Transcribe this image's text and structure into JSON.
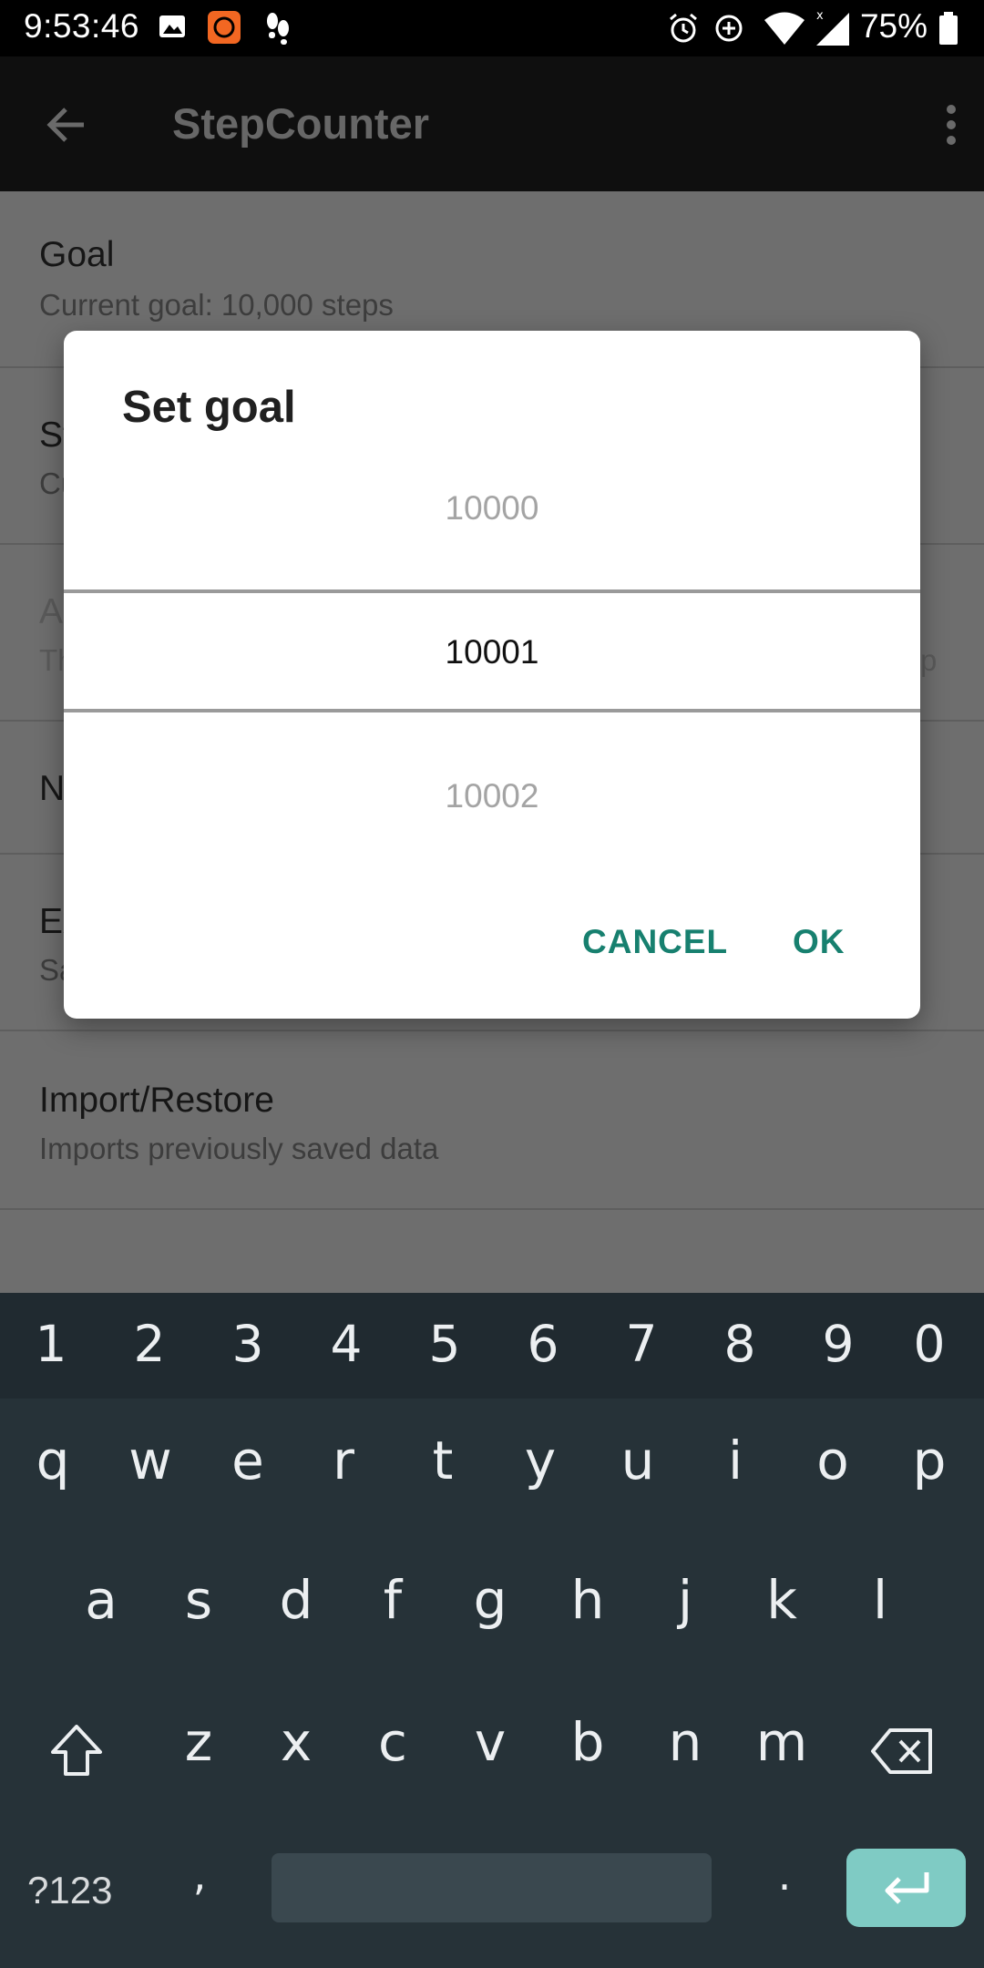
{
  "status_bar": {
    "time": "9:53:46",
    "battery": "75%"
  },
  "app_bar": {
    "title": "StepCounter"
  },
  "settings": [
    {
      "title": "Goal",
      "subtitle": "Current goal: 10,000 steps"
    },
    {
      "title": "St",
      "subtitle": "Cu"
    },
    {
      "title": "A",
      "subtitle": "Th",
      "trail": "p"
    },
    {
      "title": "N",
      "subtitle": ""
    },
    {
      "title": "Ex",
      "subtitle": "Sa"
    },
    {
      "title": "Import/Restore",
      "subtitle": "Imports previously saved data"
    }
  ],
  "dialog": {
    "title": "Set goal",
    "prev_value": "10000",
    "current_value": "10001",
    "next_value": "10002",
    "cancel_label": "CANCEL",
    "ok_label": "OK"
  },
  "keyboard": {
    "number_row": [
      "1",
      "2",
      "3",
      "4",
      "5",
      "6",
      "7",
      "8",
      "9",
      "0"
    ],
    "row1": [
      "q",
      "w",
      "e",
      "r",
      "t",
      "y",
      "u",
      "i",
      "o",
      "p"
    ],
    "row2": [
      "a",
      "s",
      "d",
      "f",
      "g",
      "h",
      "j",
      "k",
      "l"
    ],
    "row3": [
      "z",
      "x",
      "c",
      "v",
      "b",
      "n",
      "m"
    ],
    "symbols_label": "?123",
    "comma": ",",
    "period": "."
  }
}
